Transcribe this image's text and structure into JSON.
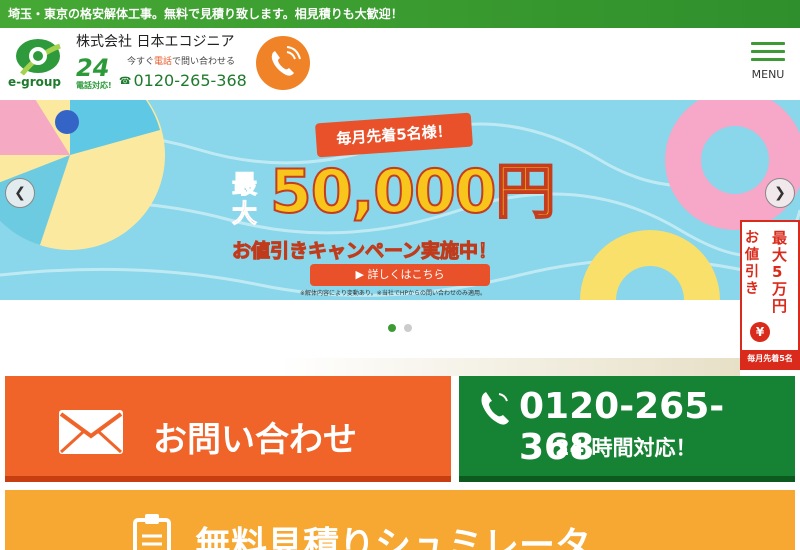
{
  "topbar": {
    "text": "埼玉・東京の格安解体工事。無料で見積り致します。相見積りも大歓迎！"
  },
  "header": {
    "logo_text": "e-group",
    "company": "株式会社 日本エコジニア",
    "hours_big": "24",
    "hours_sub": "電話対応!",
    "call_prefix": "今すぐ",
    "call_accent": "電話",
    "call_suffix": "で問い合わせる",
    "freedial_mark": "☎",
    "phone": "0120-265-368",
    "menu_label": "MENU"
  },
  "hero": {
    "badge": "毎月先着5名様！",
    "big_prefix": "最大",
    "big_amount": "50,000円",
    "campaign": "お値引きキャンペーン実施中！",
    "detail_button": "▶ 詳しくはこちら",
    "disclaimer": "※解体内容により変動あり。※当社でHPからの問い合わせのみ適用。",
    "prev": "❮",
    "next": "❯"
  },
  "side_tab": {
    "left": "お値引き",
    "right": "最大5万円",
    "yen": "¥",
    "footer": "毎月先着5名"
  },
  "actions": {
    "contact_label": "お問い合わせ",
    "tel_number": "0120-265-368",
    "tel_sub": "24 時間対応！",
    "simulator_label": "無料見積りシュミレータ"
  },
  "colors": {
    "green": "#3d9a36",
    "orange": "#f0642a",
    "dark_green": "#168234",
    "yellow": "#f6a833",
    "red": "#d92a1c"
  }
}
